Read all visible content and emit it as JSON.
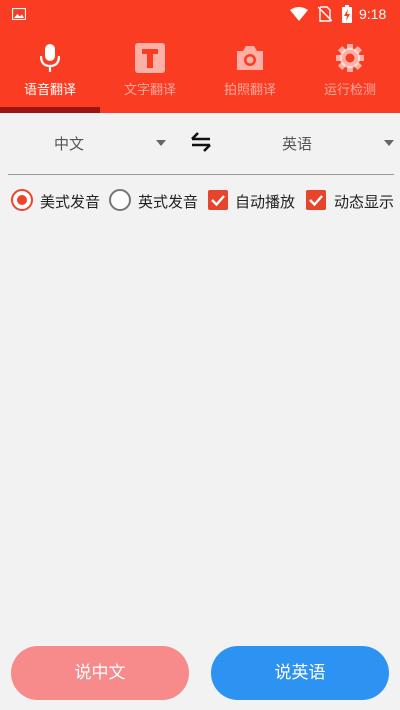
{
  "status_bar": {
    "time": "9:18",
    "icons": [
      "image-icon",
      "wifi-icon",
      "no-sim-icon",
      "battery-charging-icon"
    ]
  },
  "tabs": [
    {
      "label": "语音翻译",
      "icon": "microphone-icon",
      "active": true
    },
    {
      "label": "文字翻译",
      "icon": "text-t-icon",
      "active": false
    },
    {
      "label": "拍照翻译",
      "icon": "camera-icon",
      "active": false
    },
    {
      "label": "运行检测",
      "icon": "gear-icon",
      "active": false
    }
  ],
  "languages": {
    "source": "中文",
    "target": "英语",
    "swap_icon": "swap-arrows-icon"
  },
  "options": {
    "us_pronunciation": {
      "label": "美式发音",
      "checked": true
    },
    "uk_pronunciation": {
      "label": "英式发音",
      "checked": false
    },
    "auto_play": {
      "label": "自动播放",
      "checked": true
    },
    "dynamic_display": {
      "label": "动态显示",
      "checked": true
    }
  },
  "buttons": {
    "speak_chinese": "说中文",
    "speak_english": "说英语"
  },
  "colors": {
    "header": "#fa3d22",
    "tab_indicator": "#9a1610",
    "accent": "#f0432b",
    "button_chinese": "#f78a8a",
    "button_english": "#2c93f2",
    "background": "#f2f2f2"
  }
}
